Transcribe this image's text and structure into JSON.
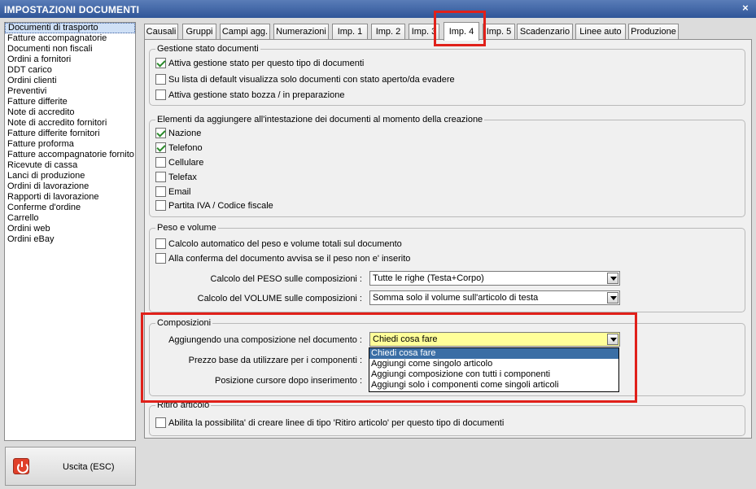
{
  "window": {
    "title": "IMPOSTAZIONI DOCUMENTI",
    "close_glyph": "×"
  },
  "sidebar": {
    "items": [
      {
        "label": "Documenti di trasporto",
        "selected": true
      },
      {
        "label": "Fatture accompagnatorie"
      },
      {
        "label": "Documenti non fiscali"
      },
      {
        "label": "Ordini a fornitori"
      },
      {
        "label": "DDT carico"
      },
      {
        "label": "Ordini clienti"
      },
      {
        "label": "Preventivi"
      },
      {
        "label": "Fatture differite"
      },
      {
        "label": "Note di accredito"
      },
      {
        "label": "Note di accredito fornitori"
      },
      {
        "label": "Fatture differite fornitori"
      },
      {
        "label": "Fatture proforma"
      },
      {
        "label": "Fatture accompagnatorie fornito"
      },
      {
        "label": "Ricevute di cassa"
      },
      {
        "label": "Lanci di produzione"
      },
      {
        "label": "Ordini di lavorazione"
      },
      {
        "label": "Rapporti di lavorazione"
      },
      {
        "label": "Conferme d'ordine"
      },
      {
        "label": "Carrello"
      },
      {
        "label": "Ordini web"
      },
      {
        "label": "Ordini eBay"
      }
    ]
  },
  "exit_button": {
    "label": "Uscita (ESC)",
    "icon": "power-icon"
  },
  "tabs": [
    {
      "label": "Causali"
    },
    {
      "label": "Gruppi"
    },
    {
      "label": "Campi agg."
    },
    {
      "label": "Numerazioni"
    },
    {
      "label": "Imp. 1"
    },
    {
      "label": "Imp. 2"
    },
    {
      "label": "Imp. 3"
    },
    {
      "label": "Imp. 4",
      "active": true
    },
    {
      "label": "Imp. 5"
    },
    {
      "label": "Scadenzario"
    },
    {
      "label": "Linee auto"
    },
    {
      "label": "Produzione"
    }
  ],
  "gestione_stato": {
    "title": "Gestione stato documenti",
    "options": [
      {
        "label": "Attiva gestione stato per questo tipo di documenti",
        "checked": true
      },
      {
        "label": "Su lista di default visualizza solo documenti con stato aperto/da evadere",
        "checked": false
      },
      {
        "label": "Attiva gestione stato bozza / in preparazione",
        "checked": false
      }
    ]
  },
  "intestazione": {
    "title": "Elementi da aggiungere all'intestazione dei documenti al momento della creazione",
    "options": [
      {
        "label": "Nazione",
        "checked": true
      },
      {
        "label": "Telefono",
        "checked": true
      },
      {
        "label": "Cellulare",
        "checked": false
      },
      {
        "label": "Telefax",
        "checked": false
      },
      {
        "label": "Email",
        "checked": false
      },
      {
        "label": "Partita IVA / Codice fiscale",
        "checked": false
      }
    ]
  },
  "peso_volume": {
    "title": "Peso e volume",
    "options": [
      {
        "label": "Calcolo automatico del peso e volume totali sul documento",
        "checked": false
      },
      {
        "label": "Alla conferma del documento avvisa se il peso non e' inserito",
        "checked": false
      }
    ],
    "peso_label": "Calcolo del PESO sulle composizioni :",
    "peso_value": "Tutte le righe (Testa+Corpo)",
    "volume_label": "Calcolo del VOLUME sulle composizioni :",
    "volume_value": "Somma solo il volume sull'articolo di testa"
  },
  "composizioni": {
    "title": "Composizioni",
    "aggiungendo_label": "Aggiungendo una composizione nel documento :",
    "aggiungendo_value": "Chiedi cosa fare",
    "prezzo_label": "Prezzo base da utilizzare per i componenti :",
    "posizione_label": "Posizione cursore dopo inserimento :",
    "dropdown_options": [
      {
        "label": "Chiedi cosa fare",
        "selected": true
      },
      {
        "label": "Aggiungi come singolo articolo"
      },
      {
        "label": "Aggiungi composizione con tutti i componenti"
      },
      {
        "label": "Aggiungi solo i componenti come singoli articoli"
      }
    ]
  },
  "ritiro": {
    "title": "Ritiro articolo",
    "options": [
      {
        "label": "Abilita la possibilita' di creare linee di tipo 'Ritiro articolo' per questo tipo di documenti",
        "checked": false
      }
    ]
  },
  "colors": {
    "highlight": "#e0201a",
    "titlebar": "#2f5598",
    "combo_yellow": "#ffff99",
    "selection": "#3a6ea5"
  }
}
